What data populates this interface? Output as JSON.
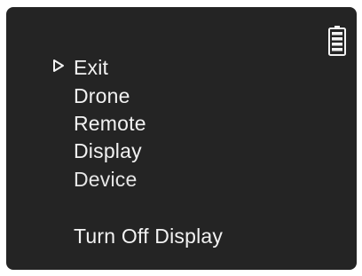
{
  "screen": {
    "background": "#242424",
    "text_color": "#f2f2f2",
    "battery_icon": "battery-icon",
    "selector_icon": "triangle-right-outline-icon"
  },
  "menu": {
    "selected_index": 0,
    "items": [
      {
        "label": "Exit"
      },
      {
        "label": "Drone"
      },
      {
        "label": "Remote"
      },
      {
        "label": "Display"
      },
      {
        "label": "Device"
      },
      {
        "label": "Turn Off Display"
      }
    ]
  }
}
